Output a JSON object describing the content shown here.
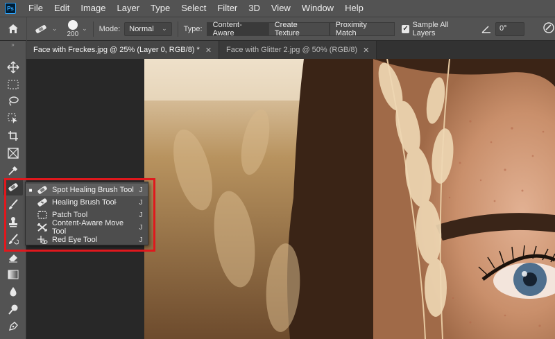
{
  "app": {
    "logo_text": "Ps"
  },
  "menubar": {
    "items": [
      "File",
      "Edit",
      "Image",
      "Layer",
      "Type",
      "Select",
      "Filter",
      "3D",
      "View",
      "Window",
      "Help"
    ]
  },
  "options": {
    "brush_size": "200",
    "mode_label": "Mode:",
    "mode_value": "Normal",
    "type_label": "Type:",
    "type_buttons": [
      "Content-Aware",
      "Create Texture",
      "Proximity Match"
    ],
    "sample_all_label": "Sample All Layers",
    "sample_all_checked": true,
    "angle_value": "0°"
  },
  "tabs": [
    {
      "title": "Face with Freckes.jpg @ 25% (Layer 0, RGB/8) *",
      "active": true
    },
    {
      "title": "Face with Glitter 2.jpg @ 50% (RGB/8)",
      "active": false
    }
  ],
  "toolbar": {
    "icons": [
      "move-icon",
      "marquee-icon",
      "lasso-icon",
      "object-select-icon",
      "crop-icon",
      "frame-icon",
      "eyedropper-icon",
      "spot-healing-icon",
      "brush-icon",
      "stamp-icon",
      "history-brush-icon",
      "eraser-icon",
      "gradient-icon",
      "blur-icon",
      "dodge-icon",
      "pen-icon"
    ]
  },
  "flyout": {
    "items": [
      {
        "label": "Spot Healing Brush Tool",
        "shortcut": "J",
        "selected": true,
        "icon": "spot-healing-icon"
      },
      {
        "label": "Healing Brush Tool",
        "shortcut": "J",
        "selected": false,
        "icon": "healing-brush-icon"
      },
      {
        "label": "Patch Tool",
        "shortcut": "J",
        "selected": false,
        "icon": "patch-icon"
      },
      {
        "label": "Content-Aware Move Tool",
        "shortcut": "J",
        "selected": false,
        "icon": "content-aware-move-icon"
      },
      {
        "label": "Red Eye Tool",
        "shortcut": "J",
        "selected": false,
        "icon": "red-eye-icon"
      }
    ],
    "highlight_color": "#e0181d"
  }
}
